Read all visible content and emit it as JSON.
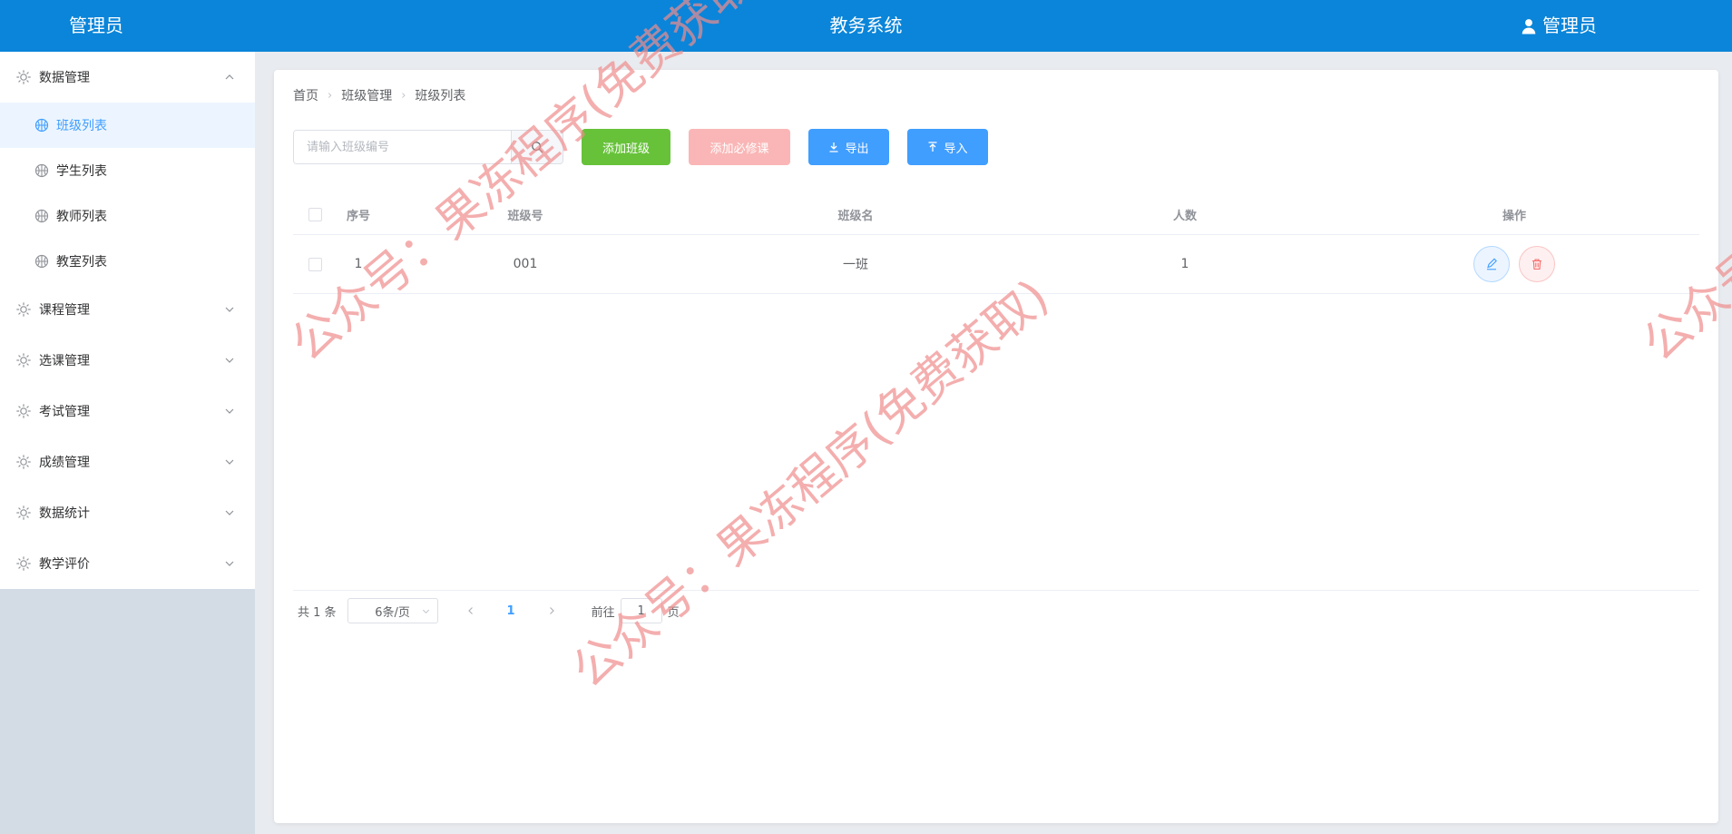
{
  "header": {
    "left_title": "管理员",
    "center_title": "教务系统",
    "user_label": "管理员"
  },
  "sidebar": {
    "groups": [
      {
        "label": "数据管理",
        "expanded": true,
        "items": [
          {
            "label": "班级列表",
            "active": true
          },
          {
            "label": "学生列表"
          },
          {
            "label": "教师列表"
          },
          {
            "label": "教室列表"
          }
        ]
      },
      {
        "label": "课程管理"
      },
      {
        "label": "选课管理"
      },
      {
        "label": "考试管理"
      },
      {
        "label": "成绩管理"
      },
      {
        "label": "数据统计"
      },
      {
        "label": "教学评价"
      }
    ]
  },
  "breadcrumb": [
    "首页",
    "班级管理",
    "班级列表"
  ],
  "toolbar": {
    "search_placeholder": "请输入班级编号",
    "add_class_label": "添加班级",
    "add_required_label": "添加必修课",
    "export_label": "导出",
    "import_label": "导入"
  },
  "table": {
    "columns": [
      "序号",
      "班级号",
      "班级名",
      "人数",
      "操作"
    ],
    "rows": [
      {
        "index": "1",
        "code": "001",
        "name": "一班",
        "count": "1"
      }
    ]
  },
  "pagination": {
    "total_label": "共 1 条",
    "page_size_label": "6条/页",
    "current_page": "1",
    "goto_label": "前往",
    "goto_value": "1",
    "page_suffix": "页"
  },
  "watermark": {
    "text": "公众号：果冻程序(免费获取)",
    "color": "#f08c8c"
  },
  "colors": {
    "header_bg": "#0a85d9",
    "accent": "#409eff",
    "success": "#67c23a",
    "danger_light": "#fab6b6"
  }
}
